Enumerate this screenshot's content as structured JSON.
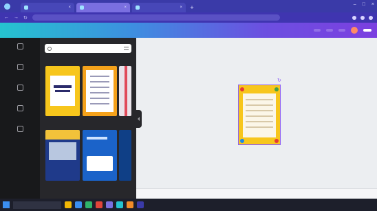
{
  "browser": {
    "tabs": [
      {
        "label": "",
        "active": false
      },
      {
        "label": "",
        "active": true
      },
      {
        "label": "",
        "active": false
      }
    ],
    "new_tab_icon": "plus-icon",
    "url": ""
  },
  "header": {
    "home": "",
    "file": "",
    "resize": "",
    "doc_title": "",
    "actions": [
      "",
      "",
      ""
    ],
    "share": ""
  },
  "rail": {
    "items": [
      {
        "label": "",
        "icon": "templates-icon"
      },
      {
        "label": "",
        "icon": "elements-icon"
      },
      {
        "label": "",
        "icon": "uploads-icon"
      },
      {
        "label": "",
        "icon": "text-icon"
      },
      {
        "label": "",
        "icon": "more-icon"
      }
    ]
  },
  "panel": {
    "search_placeholder": "",
    "sections": [
      {
        "title": "",
        "link": ""
      },
      {
        "title": "",
        "link": ""
      },
      {
        "title": "",
        "link": ""
      }
    ]
  },
  "canvas": {
    "page_label": "",
    "caption": "",
    "footer_left": "",
    "zoom": ""
  },
  "taskbar": {
    "search": "",
    "clock": ""
  },
  "colors": {
    "brand_gradient_start": "#25c3cf",
    "brand_gradient_end": "#7b3fe0",
    "design_yellow": "#f7c61c",
    "selection": "#8b5cf6"
  }
}
